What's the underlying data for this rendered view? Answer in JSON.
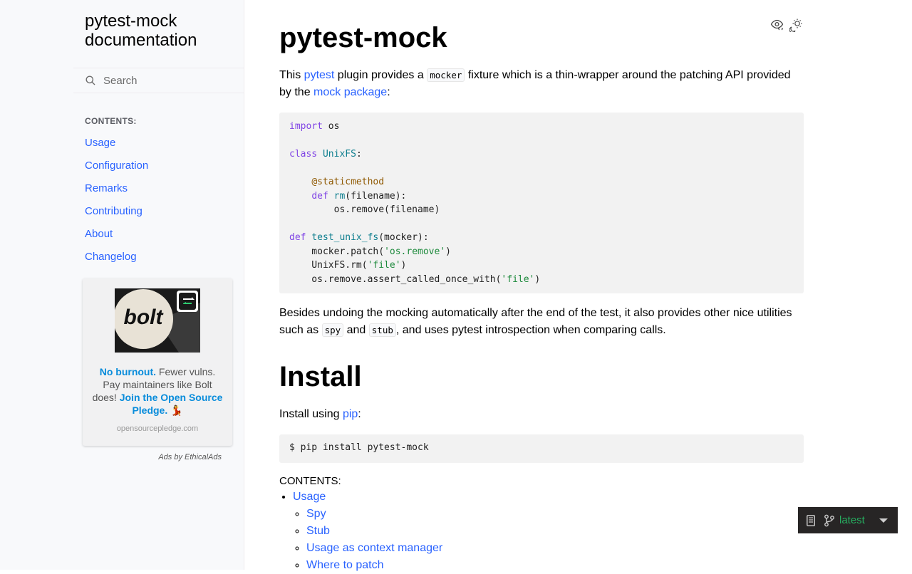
{
  "sidebar": {
    "brand_line1": "pytest-mock",
    "brand_line2": "documentation",
    "search_placeholder": "Search",
    "toc_caption": "CONTENTS:",
    "toc_items": [
      "Usage",
      "Configuration",
      "Remarks",
      "Contributing",
      "About",
      "Changelog"
    ]
  },
  "ad": {
    "logo_text": "bolt",
    "text_strong1": "No burnout.",
    "text_plain": " Fewer vulns. Pay maintainers like Bolt does!",
    "text_strong2": "Join the Open Source Pledge.",
    "text_emoji": "💃",
    "domain": "opensourcepledge.com",
    "footer": "Ads by EthicalAds"
  },
  "main": {
    "title": "pytest-mock",
    "intro": {
      "p1": "This ",
      "link_pytest": "pytest",
      "p2": " plugin provides a ",
      "code_mocker": "mocker",
      "p3": " fixture which is a thin-wrapper around the patching API provided by the ",
      "link_mock": "mock package",
      "p4": ":"
    },
    "code_lines": [
      "import os",
      "",
      "class UnixFS:",
      "",
      "    @staticmethod",
      "    def rm(filename):",
      "        os.remove(filename)",
      "",
      "def test_unix_fs(mocker):",
      "    mocker.patch('os.remove')",
      "    UnixFS.rm('file')",
      "    os.remove.assert_called_once_with('file')"
    ],
    "besides": {
      "p1": "Besides undoing the mocking automatically after the end of the test, it also provides other nice utilities such as ",
      "code_spy": "spy",
      "p2": " and ",
      "code_stub": "stub",
      "p3": ", and uses pytest introspection when comparing calls."
    },
    "install_title": "Install",
    "install_text": "Install using ",
    "install_link": "pip",
    "install_colon": ":",
    "install_cmd": "$ pip install pytest-mock",
    "contents_caption": "CONTENTS:",
    "contents": {
      "usage": "Usage",
      "sub": [
        "Spy",
        "Stub",
        "Usage as context manager",
        "Where to patch"
      ]
    }
  },
  "rtd": {
    "version": "latest"
  },
  "colors": {
    "link": "#2962ff",
    "sidebar_bg": "#f8f9fb",
    "code_bg": "#f2f2f2",
    "rtd_green": "#27ae60"
  }
}
